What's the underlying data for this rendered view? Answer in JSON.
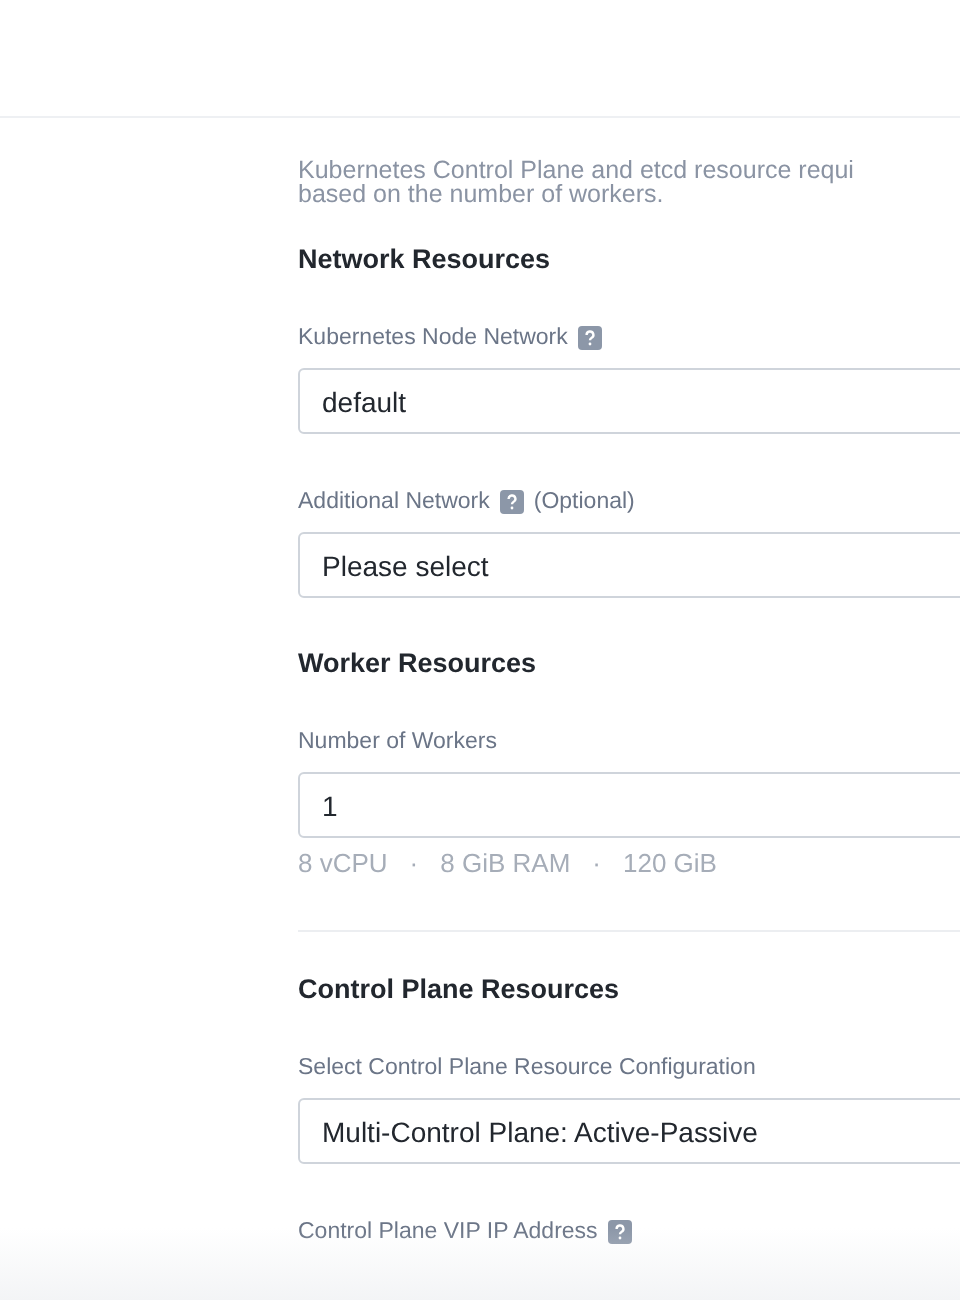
{
  "description": "Kubernetes Control Plane and etcd resource requi\nbased on the number of workers.",
  "sections": [
    {
      "title": "Network Resources",
      "divider": false,
      "fields": [
        {
          "label": "Kubernetes Node Network",
          "help": true,
          "value": "default"
        },
        {
          "label": "Additional Network",
          "help": true,
          "optional": "(Optional)",
          "value": "Please select"
        }
      ]
    },
    {
      "title": "Worker Resources",
      "divider": false,
      "fields": [
        {
          "label": "Number of Workers",
          "help": false,
          "value": "1",
          "hint": [
            "8 vCPU",
            "·",
            "8 GiB RAM",
            "·",
            "120 GiB"
          ]
        }
      ]
    },
    {
      "title": "Control Plane Resources",
      "divider": true,
      "fields": [
        {
          "label": "Select Control Plane Resource Configuration",
          "help": false,
          "value": "Multi-Control Plane: Active-Passive"
        },
        {
          "label": "Control Plane VIP IP Address",
          "help": true
        }
      ]
    }
  ]
}
